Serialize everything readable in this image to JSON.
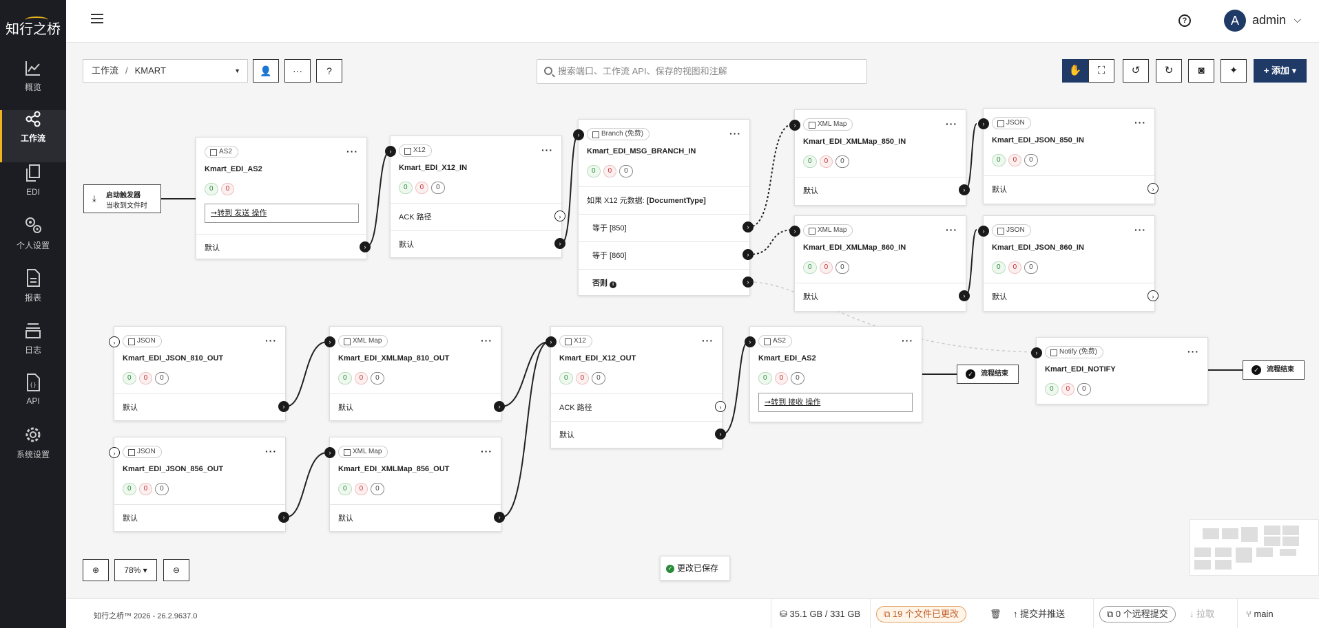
{
  "brand": {
    "name": "知行之桥"
  },
  "nav": [
    {
      "label": "概览",
      "icon": "chart-line-icon"
    },
    {
      "label": "工作流",
      "icon": "share-nodes-icon",
      "active": true
    },
    {
      "label": "EDI",
      "icon": "documents-icon"
    },
    {
      "label": "个人设置",
      "icon": "user-gears-icon"
    },
    {
      "label": "报表",
      "icon": "report-icon"
    },
    {
      "label": "日志",
      "icon": "layers-icon"
    },
    {
      "label": "API",
      "icon": "api-file-icon"
    },
    {
      "label": "系统设置",
      "icon": "gear-icon"
    }
  ],
  "header": {
    "help": "?",
    "avatar": "A",
    "user": "admin"
  },
  "toolbar": {
    "breadcrumb_root": "工作流",
    "breadcrumb_sep": "/",
    "breadcrumb_current": "KMART",
    "search_placeholder": "搜索端口、工作流 API、保存的视图和注解",
    "add_label": "+ 添加"
  },
  "trigger": {
    "title": "启动触发器",
    "subtitle": "当收到文件时"
  },
  "nodes": [
    {
      "type": "AS2",
      "name": "Kmart_EDI_AS2",
      "ok": "0",
      "err": "0",
      "goto": "转到 发送 操作",
      "default": "默认"
    },
    {
      "type": "X12",
      "name": "Kmart_EDI_X12_IN",
      "ok": "0",
      "err": "0",
      "pend": "0",
      "ack": "ACK 路径",
      "default": "默认"
    },
    {
      "type": "Branch (免费)",
      "name": "Kmart_EDI_MSG_BRANCH_IN",
      "ok": "0",
      "err": "0",
      "pend": "0",
      "cond_prefix": "如果 X12 元数据:",
      "cond_field": "[DocumentType]",
      "eq1": "等于 [850]",
      "eq2": "等于 [860]",
      "else": "否则"
    },
    {
      "type": "XML Map",
      "name": "Kmart_EDI_XMLMap_850_IN",
      "ok": "0",
      "err": "0",
      "pend": "0",
      "default": "默认"
    },
    {
      "type": "JSON",
      "name": "Kmart_EDI_JSON_850_IN",
      "ok": "0",
      "err": "0",
      "pend": "0",
      "default": "默认"
    },
    {
      "type": "XML Map",
      "name": "Kmart_EDI_XMLMap_860_IN",
      "ok": "0",
      "err": "0",
      "pend": "0",
      "default": "默认"
    },
    {
      "type": "JSON",
      "name": "Kmart_EDI_JSON_860_IN",
      "ok": "0",
      "err": "0",
      "pend": "0",
      "default": "默认"
    },
    {
      "type": "JSON",
      "name": "Kmart_EDI_JSON_810_OUT",
      "ok": "0",
      "err": "0",
      "pend": "0",
      "default": "默认"
    },
    {
      "type": "XML Map",
      "name": "Kmart_EDI_XMLMap_810_OUT",
      "ok": "0",
      "err": "0",
      "pend": "0",
      "default": "默认"
    },
    {
      "type": "X12",
      "name": "Kmart_EDI_X12_OUT",
      "ok": "0",
      "err": "0",
      "pend": "0",
      "ack": "ACK 路径",
      "default": "默认"
    },
    {
      "type": "AS2",
      "name": "Kmart_EDI_AS2",
      "ok": "0",
      "err": "0",
      "pend": "0",
      "goto": "转到 接收 操作"
    },
    {
      "type": "Notify (免费)",
      "name": "Kmart_EDI_NOTIFY",
      "ok": "0",
      "err": "0",
      "pend": "0"
    },
    {
      "type": "JSON",
      "name": "Kmart_EDI_JSON_856_OUT",
      "ok": "0",
      "err": "0",
      "pend": "0",
      "default": "默认"
    },
    {
      "type": "XML Map",
      "name": "Kmart_EDI_XMLMap_856_OUT",
      "ok": "0",
      "err": "0",
      "pend": "0",
      "default": "默认"
    }
  ],
  "end_label": "流程结束",
  "zoom": {
    "level": "78%"
  },
  "saved": "更改已保存",
  "footer": {
    "version": "知行之桥™ 2026 - 26.2.9637.0",
    "storage": "35.1 GB / 331 GB",
    "changed": "19 个文件已更改",
    "commit_push": "提交并推送",
    "remote_commits": "0 个远程提交",
    "pull": "拉取",
    "branch": "main"
  }
}
